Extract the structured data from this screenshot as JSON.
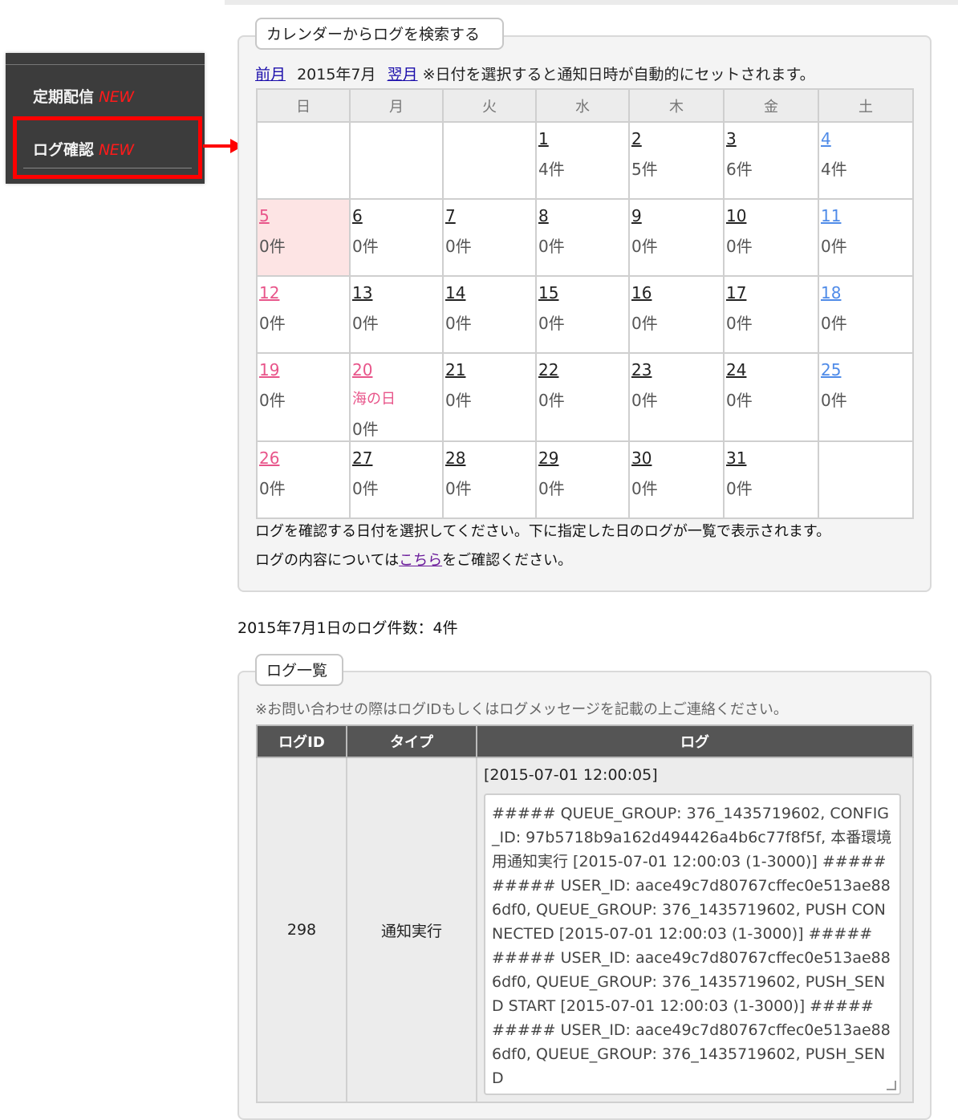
{
  "sidebar": {
    "items": [
      {
        "label": "定期配信",
        "badge": "NEW"
      },
      {
        "label": "ログ確認",
        "badge": "NEW"
      }
    ]
  },
  "calendar_panel": {
    "legend": "カレンダーからログを検索する",
    "prev_label": "前月",
    "month_label": "2015年7月",
    "next_label": "翌月",
    "nav_note": "※日付を選択すると通知日時が自動的にセットされます。",
    "weekdays": [
      "日",
      "月",
      "火",
      "水",
      "木",
      "金",
      "土"
    ],
    "weeks": [
      [
        null,
        null,
        null,
        {
          "day": "1",
          "count": "4件"
        },
        {
          "day": "2",
          "count": "5件"
        },
        {
          "day": "3",
          "count": "6件"
        },
        {
          "day": "4",
          "count": "4件"
        }
      ],
      [
        {
          "day": "5",
          "count": "0件",
          "selected": true
        },
        {
          "day": "6",
          "count": "0件"
        },
        {
          "day": "7",
          "count": "0件"
        },
        {
          "day": "8",
          "count": "0件"
        },
        {
          "day": "9",
          "count": "0件"
        },
        {
          "day": "10",
          "count": "0件"
        },
        {
          "day": "11",
          "count": "0件"
        }
      ],
      [
        {
          "day": "12",
          "count": "0件"
        },
        {
          "day": "13",
          "count": "0件"
        },
        {
          "day": "14",
          "count": "0件"
        },
        {
          "day": "15",
          "count": "0件"
        },
        {
          "day": "16",
          "count": "0件"
        },
        {
          "day": "17",
          "count": "0件"
        },
        {
          "day": "18",
          "count": "0件"
        }
      ],
      [
        {
          "day": "19",
          "count": "0件"
        },
        {
          "day": "20",
          "count": "0件",
          "holiday": "海の日"
        },
        {
          "day": "21",
          "count": "0件"
        },
        {
          "day": "22",
          "count": "0件"
        },
        {
          "day": "23",
          "count": "0件"
        },
        {
          "day": "24",
          "count": "0件"
        },
        {
          "day": "25",
          "count": "0件"
        }
      ],
      [
        {
          "day": "26",
          "count": "0件"
        },
        {
          "day": "27",
          "count": "0件"
        },
        {
          "day": "28",
          "count": "0件"
        },
        {
          "day": "29",
          "count": "0件"
        },
        {
          "day": "30",
          "count": "0件"
        },
        {
          "day": "31",
          "count": "0件"
        },
        null
      ]
    ],
    "note1": "ログを確認する日付を選択してください。下に指定した日のログが一覧で表示されます。",
    "note2_prefix": "ログの内容については",
    "note2_link": "こちら",
    "note2_suffix": "をご確認ください。"
  },
  "log_count_text": "2015年7月1日のログ件数：4件",
  "log_panel": {
    "legend": "ログ一覧",
    "note": "※お問い合わせの際はログIDもしくはログメッセージを記載の上ご連絡ください。",
    "columns": [
      "ログID",
      "タイプ",
      "ログ"
    ],
    "rows": [
      {
        "id": "298",
        "type": "通知実行",
        "timestamp": "[2015-07-01 12:00:05]",
        "message": "##### QUEUE_GROUP: 376_1435719602, CONFIG_ID: 97b5718b9a162d494426a4b6c77f8f5f, 本番環境用通知実行 [2015-07-01 12:00:03 (1-3000)] #####\n##### USER_ID: aace49c7d80767cffec0e513ae886df0, QUEUE_GROUP: 376_1435719602, PUSH CONNECTED [2015-07-01 12:00:03 (1-3000)] #####\n##### USER_ID: aace49c7d80767cffec0e513ae886df0, QUEUE_GROUP: 376_1435719602, PUSH_SEND START [2015-07-01 12:00:03 (1-3000)] #####\n##### USER_ID: aace49c7d80767cffec0e513ae886df0, QUEUE_GROUP: 376_1435719602, PUSH_SEND"
      }
    ]
  },
  "colors": {
    "sidebar_bg": "#3c3c3c",
    "highlight": "#ff0000",
    "sunday": "#e8558a",
    "saturday": "#4f8be8",
    "selected_day_bg": "#fde4e4",
    "table_header_bg": "#555555"
  }
}
